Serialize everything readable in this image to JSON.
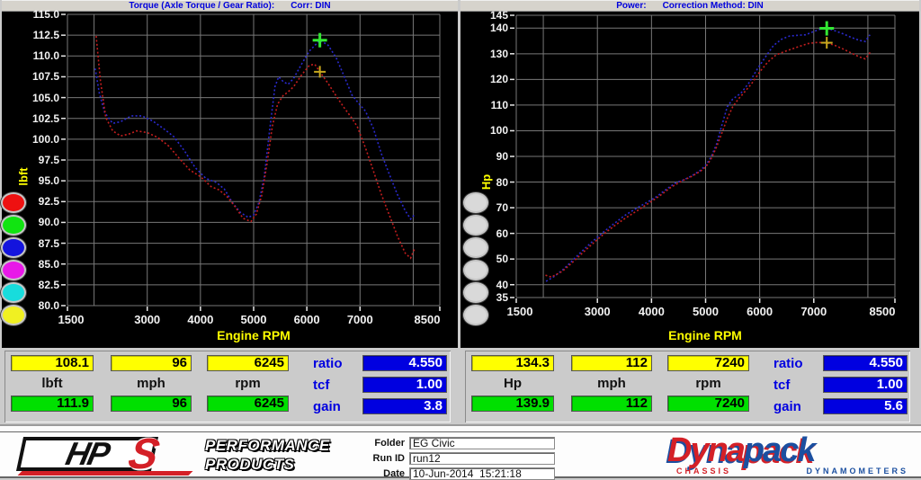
{
  "left_table": {
    "top": [
      "108.1",
      "96",
      "6245"
    ],
    "units": [
      "lbft",
      "mph",
      "rpm"
    ],
    "bottom": [
      "111.9",
      "96",
      "6245"
    ],
    "side_labels": [
      "ratio",
      "tcf",
      "gain"
    ],
    "side_values": [
      "4.550",
      "1.00",
      "3.8"
    ]
  },
  "right_table": {
    "top": [
      "134.3",
      "112",
      "7240"
    ],
    "units": [
      "Hp",
      "mph",
      "rpm"
    ],
    "bottom": [
      "139.9",
      "112",
      "7240"
    ],
    "side_labels": [
      "ratio",
      "tcf",
      "gain"
    ],
    "side_values": [
      "4.550",
      "1.00",
      "5.6"
    ]
  },
  "footer": {
    "hps_black": "HP",
    "hps_red": "S",
    "perf_line1": "PERFORMANCE",
    "perf_line2": "PRODUCTS",
    "fields": [
      {
        "label": "Folder",
        "value": "EG Civic"
      },
      {
        "label": "Run ID",
        "value": "run12"
      },
      {
        "label": "Date",
        "value": "10-Jun-2014  15:21:18"
      }
    ],
    "dynapack_red": "Dyna",
    "dynapack_blue": "pack",
    "dynapack_sub1": "CHASSIS",
    "dynapack_sub2": "DYNAMOMETERS"
  },
  "run_buttons": {
    "left_colors": [
      "#ee1111",
      "#11e411",
      "#1414dd",
      "#e818e8",
      "#18dcdc",
      "#f0f022"
    ],
    "right_colors": [
      "#d9d9d9",
      "#d9d9d9",
      "#d9d9d9",
      "#d9d9d9",
      "#d9d9d9",
      "#d9d9d9"
    ]
  },
  "chart_data": [
    {
      "type": "line",
      "title": "Torque (Axle Torque / Gear Ratio):",
      "correction": "Corr: DIN",
      "xlabel": "Engine RPM",
      "ylabel": "lbft",
      "xlim": [
        1500,
        8500
      ],
      "ylim": [
        80,
        115
      ],
      "grid": true,
      "legend": "none",
      "yticks": [
        {
          "label": "115.0",
          "v": 115
        },
        {
          "label": "112.5",
          "v": 112.5
        },
        {
          "label": "110.0",
          "v": 110
        },
        {
          "label": "107.5",
          "v": 107.5
        },
        {
          "label": "105.0",
          "v": 105
        },
        {
          "label": "102.5",
          "v": 102.5
        },
        {
          "label": "100.0",
          "v": 100
        },
        {
          "label": "97.5",
          "v": 97.5
        },
        {
          "label": "95.0",
          "v": 95
        },
        {
          "label": "92.5",
          "v": 92.5
        },
        {
          "label": "90.0",
          "v": 90
        },
        {
          "label": "87.5",
          "v": 87.5
        },
        {
          "label": "85.0",
          "v": 85
        },
        {
          "label": "82.5",
          "v": 82.5
        },
        {
          "label": "80.0",
          "v": 80
        }
      ],
      "xticks": [
        {
          "label": "1500",
          "v": 1500
        },
        {
          "label": "3000",
          "v": 3000
        },
        {
          "label": "4000",
          "v": 4000
        },
        {
          "label": "5000",
          "v": 5000
        },
        {
          "label": "6000",
          "v": 6000
        },
        {
          "label": "7000",
          "v": 7000
        },
        {
          "label": "8500",
          "v": 8500
        }
      ],
      "xgrid": [
        2000,
        3000,
        4000,
        5000,
        6000,
        7000,
        8000
      ],
      "series": [
        {
          "name": "blue_run_torque_lbft",
          "color": "#2a2ace",
          "points": [
            [
              2020,
              108.5
            ],
            [
              2100,
              105.5
            ],
            [
              2200,
              103.2
            ],
            [
              2350,
              101.9
            ],
            [
              2500,
              102.1
            ],
            [
              2700,
              102.8
            ],
            [
              2900,
              102.8
            ],
            [
              3100,
              102.2
            ],
            [
              3300,
              101.3
            ],
            [
              3500,
              100.3
            ],
            [
              3700,
              98.6
            ],
            [
              3900,
              96.6
            ],
            [
              4100,
              95.3
            ],
            [
              4300,
              94.8
            ],
            [
              4450,
              94.0
            ],
            [
              4600,
              92.4
            ],
            [
              4750,
              91.2
            ],
            [
              4900,
              90.6
            ],
            [
              5000,
              90.9
            ],
            [
              5100,
              92.4
            ],
            [
              5200,
              95.5
            ],
            [
              5300,
              101.0
            ],
            [
              5400,
              106.3
            ],
            [
              5470,
              107.5
            ],
            [
              5560,
              106.9
            ],
            [
              5650,
              106.6
            ],
            [
              5750,
              107.3
            ],
            [
              5900,
              109.0
            ],
            [
              6050,
              110.6
            ],
            [
              6245,
              111.9
            ],
            [
              6400,
              111.3
            ],
            [
              6550,
              109.8
            ],
            [
              6700,
              107.6
            ],
            [
              6850,
              105.3
            ],
            [
              7000,
              104.1
            ],
            [
              7100,
              103.4
            ],
            [
              7250,
              101.3
            ],
            [
              7400,
              98.3
            ],
            [
              7550,
              95.8
            ],
            [
              7700,
              93.4
            ],
            [
              7850,
              91.4
            ],
            [
              7950,
              90.4
            ],
            [
              8020,
              90.9
            ]
          ]
        },
        {
          "name": "red_run_torque_lbft",
          "color": "#c41e1e",
          "points": [
            [
              2040,
              112.4
            ],
            [
              2120,
              107.0
            ],
            [
              2220,
              102.6
            ],
            [
              2350,
              101.0
            ],
            [
              2500,
              100.4
            ],
            [
              2650,
              100.6
            ],
            [
              2800,
              101.0
            ],
            [
              3000,
              100.8
            ],
            [
              3200,
              100.2
            ],
            [
              3400,
              99.2
            ],
            [
              3600,
              97.7
            ],
            [
              3800,
              96.3
            ],
            [
              4000,
              95.5
            ],
            [
              4200,
              94.3
            ],
            [
              4350,
              93.9
            ],
            [
              4500,
              93.1
            ],
            [
              4650,
              91.9
            ],
            [
              4800,
              90.5
            ],
            [
              4950,
              90.1
            ],
            [
              5050,
              91.0
            ],
            [
              5150,
              93.2
            ],
            [
              5250,
              97.0
            ],
            [
              5350,
              101.5
            ],
            [
              5450,
              104.2
            ],
            [
              5550,
              105.2
            ],
            [
              5650,
              105.7
            ],
            [
              5750,
              106.3
            ],
            [
              5900,
              107.7
            ],
            [
              6050,
              108.9
            ],
            [
              6150,
              109.0
            ],
            [
              6245,
              108.1
            ],
            [
              6400,
              106.7
            ],
            [
              6550,
              105.2
            ],
            [
              6700,
              103.8
            ],
            [
              6850,
              102.5
            ],
            [
              6950,
              101.5
            ],
            [
              7100,
              99.0
            ],
            [
              7250,
              96.2
            ],
            [
              7400,
              93.4
            ],
            [
              7550,
              90.9
            ],
            [
              7700,
              88.4
            ],
            [
              7850,
              86.3
            ],
            [
              7950,
              85.7
            ],
            [
              8030,
              86.9
            ]
          ]
        }
      ],
      "markers": [
        {
          "x": 6245,
          "y": 111.9,
          "color": "#33e833",
          "size": 16,
          "w": 3
        },
        {
          "x": 6245,
          "y": 108.1,
          "color": "#c8a81e",
          "size": 13,
          "w": 2
        }
      ]
    },
    {
      "type": "line",
      "title": "Power:",
      "correction": "Correction Method: DIN",
      "xlabel": "Engine RPM",
      "ylabel": "Hp",
      "xlim": [
        1500,
        8500
      ],
      "ylim": [
        35,
        145
      ],
      "grid": true,
      "legend": "none",
      "yticks": [
        {
          "label": "145",
          "v": 145
        },
        {
          "label": "140",
          "v": 140
        },
        {
          "label": "130",
          "v": 130
        },
        {
          "label": "120",
          "v": 120
        },
        {
          "label": "110",
          "v": 110
        },
        {
          "label": "100",
          "v": 100
        },
        {
          "label": "90",
          "v": 90
        },
        {
          "label": "80",
          "v": 80
        },
        {
          "label": "70",
          "v": 70
        },
        {
          "label": "60",
          "v": 60
        },
        {
          "label": "50",
          "v": 50
        },
        {
          "label": "40",
          "v": 40
        },
        {
          "label": "35",
          "v": 35
        }
      ],
      "xticks": [
        {
          "label": "1500",
          "v": 1500
        },
        {
          "label": "3000",
          "v": 3000
        },
        {
          "label": "4000",
          "v": 4000
        },
        {
          "label": "5000",
          "v": 5000
        },
        {
          "label": "6000",
          "v": 6000
        },
        {
          "label": "7000",
          "v": 7000
        },
        {
          "label": "8500",
          "v": 8500
        }
      ],
      "xgrid": [
        2000,
        3000,
        4000,
        5000,
        6000,
        7000,
        8000
      ],
      "series": [
        {
          "name": "blue_run_power_hp",
          "color": "#2a2ace",
          "points": [
            [
              2050,
              41.3
            ],
            [
              2200,
              43.2
            ],
            [
              2350,
              45.6
            ],
            [
              2500,
              48.6
            ],
            [
              2700,
              52.8
            ],
            [
              2900,
              56.7
            ],
            [
              3100,
              60.3
            ],
            [
              3300,
              63.7
            ],
            [
              3500,
              66.9
            ],
            [
              3700,
              69.5
            ],
            [
              3900,
              71.9
            ],
            [
              4100,
              74.4
            ],
            [
              4300,
              77.6
            ],
            [
              4450,
              79.7
            ],
            [
              4600,
              80.9
            ],
            [
              4750,
              82.5
            ],
            [
              4900,
              84.5
            ],
            [
              5000,
              86.5
            ],
            [
              5100,
              89.7
            ],
            [
              5200,
              94.6
            ],
            [
              5300,
              102.0
            ],
            [
              5400,
              109.3
            ],
            [
              5500,
              112.3
            ],
            [
              5650,
              114.6
            ],
            [
              5800,
              118.6
            ],
            [
              5950,
              123.8
            ],
            [
              6100,
              128.6
            ],
            [
              6250,
              133.1
            ],
            [
              6400,
              135.6
            ],
            [
              6550,
              136.9
            ],
            [
              6700,
              137.2
            ],
            [
              6850,
              137.4
            ],
            [
              7000,
              138.7
            ],
            [
              7120,
              139.6
            ],
            [
              7240,
              139.9
            ],
            [
              7400,
              138.9
            ],
            [
              7550,
              137.7
            ],
            [
              7700,
              136.3
            ],
            [
              7850,
              135.2
            ],
            [
              7950,
              134.8
            ],
            [
              8040,
              137.4
            ]
          ]
        },
        {
          "name": "red_run_power_hp",
          "color": "#c41e1e",
          "points": [
            [
              2040,
              43.7
            ],
            [
              2150,
              43.0
            ],
            [
              2350,
              45.2
            ],
            [
              2550,
              48.9
            ],
            [
              2750,
              52.9
            ],
            [
              2950,
              56.7
            ],
            [
              3150,
              60.3
            ],
            [
              3350,
              63.5
            ],
            [
              3550,
              66.4
            ],
            [
              3750,
              69.0
            ],
            [
              3950,
              71.8
            ],
            [
              4150,
              74.6
            ],
            [
              4350,
              77.8
            ],
            [
              4550,
              80.3
            ],
            [
              4750,
              82.3
            ],
            [
              4900,
              84.2
            ],
            [
              5000,
              85.8
            ],
            [
              5100,
              89.0
            ],
            [
              5200,
              93.5
            ],
            [
              5300,
              99.0
            ],
            [
              5400,
              104.8
            ],
            [
              5500,
              109.3
            ],
            [
              5600,
              112.2
            ],
            [
              5700,
              114.6
            ],
            [
              5850,
              118.3
            ],
            [
              6000,
              122.9
            ],
            [
              6150,
              126.8
            ],
            [
              6300,
              129.5
            ],
            [
              6450,
              130.8
            ],
            [
              6600,
              131.9
            ],
            [
              6750,
              133.0
            ],
            [
              6900,
              134.0
            ],
            [
              7050,
              134.4
            ],
            [
              7240,
              134.3
            ],
            [
              7400,
              133.2
            ],
            [
              7550,
              131.8
            ],
            [
              7700,
              130.2
            ],
            [
              7850,
              128.7
            ],
            [
              7950,
              128.0
            ],
            [
              8060,
              131.0
            ]
          ]
        }
      ],
      "markers": [
        {
          "x": 7240,
          "y": 139.9,
          "color": "#33e833",
          "size": 16,
          "w": 3
        },
        {
          "x": 7240,
          "y": 134.3,
          "color": "#c8a81e",
          "size": 13,
          "w": 2
        }
      ]
    }
  ]
}
